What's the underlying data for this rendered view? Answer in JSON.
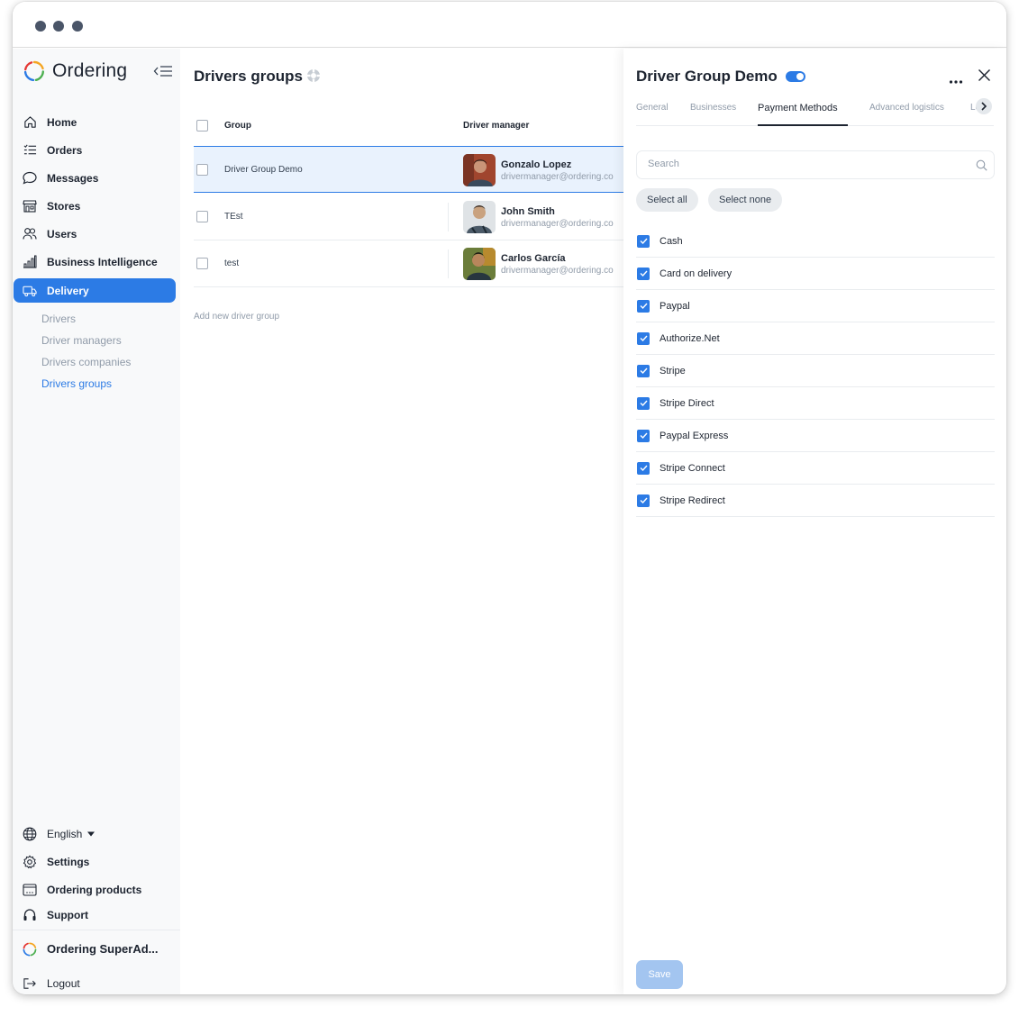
{
  "app": {
    "logo_text": "Ordering"
  },
  "sidebar": {
    "items": [
      {
        "label": "Home",
        "icon": "home-icon"
      },
      {
        "label": "Orders",
        "icon": "orders-list-icon"
      },
      {
        "label": "Messages",
        "icon": "message-bubble-icon"
      },
      {
        "label": "Stores",
        "icon": "store-icon"
      },
      {
        "label": "Users",
        "icon": "users-icon"
      },
      {
        "label": "Business Intelligence",
        "icon": "bar-chart-icon"
      },
      {
        "label": "Delivery",
        "icon": "truck-icon",
        "active": true
      }
    ],
    "delivery_sub": [
      {
        "label": "Drivers"
      },
      {
        "label": "Driver managers"
      },
      {
        "label": "Drivers companies"
      },
      {
        "label": "Drivers groups",
        "active": true
      }
    ],
    "bottom": {
      "language": "English",
      "settings": "Settings",
      "ordering_products": "Ordering products",
      "support": "Support",
      "account_name": "Ordering SuperAd...",
      "logout": "Logout"
    }
  },
  "main": {
    "title": "Drivers groups",
    "columns": {
      "group": "Group",
      "driver_manager": "Driver manager"
    },
    "rows": [
      {
        "group": "Driver Group Demo",
        "manager_name": "Gonzalo Lopez",
        "manager_email": "drivermanager@ordering.co",
        "selected": true
      },
      {
        "group": "TEst",
        "manager_name": "John Smith",
        "manager_email": "drivermanager@ordering.co"
      },
      {
        "group": "test",
        "manager_name": "Carlos García",
        "manager_email": "drivermanager@ordering.co"
      }
    ],
    "add_link": "Add new driver group"
  },
  "panel": {
    "title": "Driver Group Demo",
    "enabled": true,
    "tabs": [
      {
        "label": "General"
      },
      {
        "label": "Businesses"
      },
      {
        "label": "Payment Methods",
        "active": true
      },
      {
        "label": "Advanced logistics"
      },
      {
        "label": "Lo"
      }
    ],
    "search": {
      "placeholder": "Search",
      "value": ""
    },
    "select_all": "Select all",
    "select_none": "Select none",
    "payment_methods": [
      {
        "label": "Cash",
        "checked": true
      },
      {
        "label": "Card on delivery",
        "checked": true
      },
      {
        "label": "Paypal",
        "checked": true
      },
      {
        "label": "Authorize.Net",
        "checked": true
      },
      {
        "label": "Stripe",
        "checked": true
      },
      {
        "label": "Stripe Direct",
        "checked": true
      },
      {
        "label": "Paypal Express",
        "checked": true
      },
      {
        "label": "Stripe Connect",
        "checked": true
      },
      {
        "label": "Stripe Redirect",
        "checked": true
      }
    ],
    "save_label": "Save"
  },
  "colors": {
    "accent": "#2c7be5",
    "save_disabled": "#a3c5f0",
    "sidebar_bg": "#f8f9fa"
  }
}
